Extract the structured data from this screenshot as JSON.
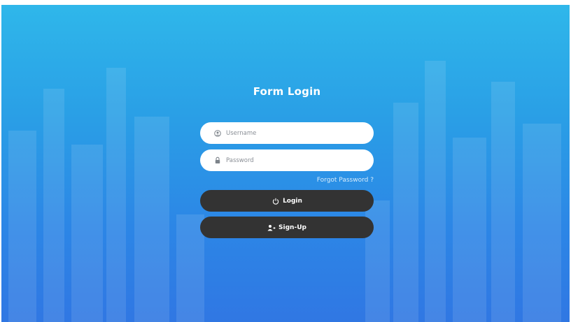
{
  "form": {
    "title": "Form Login",
    "username": {
      "placeholder": "Username",
      "value": "",
      "icon": "user-circle-icon"
    },
    "password": {
      "placeholder": "Password",
      "value": "",
      "icon": "lock-icon"
    },
    "forgot_label": "Forgot Password ?",
    "login_label": "Login",
    "login_icon": "power-icon",
    "signup_label": "Sign-Up",
    "signup_icon": "add-user-icon"
  },
  "colors": {
    "background_top": "#2fb7ea",
    "background_bottom": "#3077e3",
    "button": "#333333",
    "field": "#ffffff"
  }
}
